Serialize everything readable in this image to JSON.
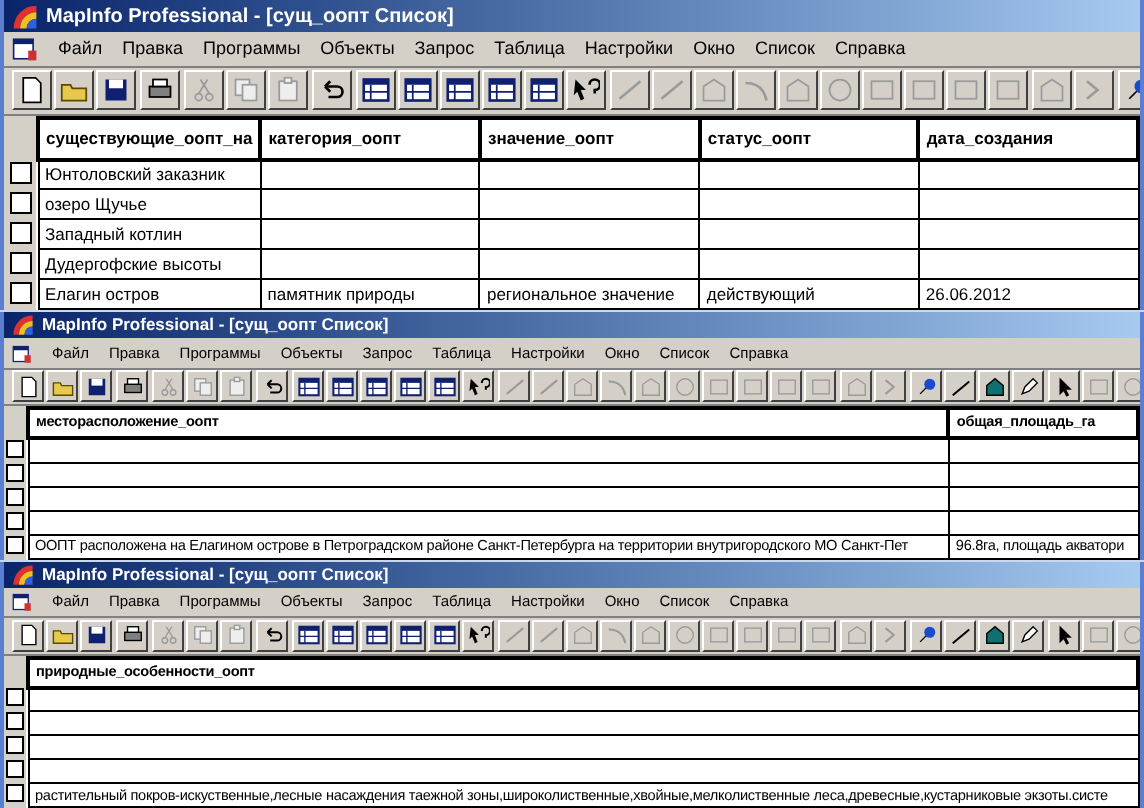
{
  "windows": [
    {
      "title": "MapInfo Professional - [сущ_оопт Список]",
      "menu": [
        "Файл",
        "Правка",
        "Программы",
        "Объекты",
        "Запрос",
        "Таблица",
        "Настройки",
        "Окно",
        "Список",
        "Справка"
      ],
      "columns": [
        "существующие_оопт_на",
        "категория_оопт",
        "значение_оопт",
        "статус_оопт",
        "дата_создания"
      ],
      "rows": [
        {
          "checked": false,
          "cells": [
            "Юнтоловский заказник",
            null,
            null,
            null,
            null
          ]
        },
        {
          "checked": false,
          "cells": [
            "озеро Щучье",
            null,
            null,
            null,
            null
          ]
        },
        {
          "checked": false,
          "cells": [
            "Западный котлин",
            null,
            null,
            null,
            null
          ]
        },
        {
          "checked": false,
          "cells": [
            "Дудергофские высоты",
            null,
            null,
            null,
            null
          ]
        },
        {
          "checked": false,
          "cells": [
            "Елагин остров",
            "памятник природы",
            "региональное значение",
            "действующий",
            "26.06.2012"
          ]
        }
      ]
    },
    {
      "title": "MapInfo Professional - [сущ_оопт Список]",
      "menu": [
        "Файл",
        "Правка",
        "Программы",
        "Объекты",
        "Запрос",
        "Таблица",
        "Настройки",
        "Окно",
        "Список",
        "Справка"
      ],
      "columns": [
        "месторасположение_оопт",
        "общая_площадь_га"
      ],
      "rows": [
        {
          "checked": false,
          "cells": [
            null,
            null
          ]
        },
        {
          "checked": false,
          "cells": [
            null,
            null
          ]
        },
        {
          "checked": false,
          "cells": [
            null,
            null
          ]
        },
        {
          "checked": false,
          "cells": [
            null,
            null
          ]
        },
        {
          "checked": false,
          "cells": [
            "ООПТ расположена на Елагином острове в Петроградском районе Санкт-Петербурга на территории внутригородского МО Санкт-Пет",
            "96.8га, площадь акватори"
          ]
        }
      ]
    },
    {
      "title": "MapInfo Professional - [сущ_оопт Список]",
      "menu": [
        "Файл",
        "Правка",
        "Программы",
        "Объекты",
        "Запрос",
        "Таблица",
        "Настройки",
        "Окно",
        "Список",
        "Справка"
      ],
      "columns": [
        "природные_особенности_оопт"
      ],
      "rows": [
        {
          "checked": false,
          "cells": [
            null
          ]
        },
        {
          "checked": false,
          "cells": [
            null
          ]
        },
        {
          "checked": false,
          "cells": [
            null
          ]
        },
        {
          "checked": false,
          "cells": [
            null
          ]
        },
        {
          "checked": false,
          "cells": [
            "растительный покров-искуственные,лесные насаждения таежной зоны,широколиственные,хвойные,мелколиственные леса,древесные,кустарниковые экзоты.систе"
          ]
        }
      ]
    }
  ]
}
